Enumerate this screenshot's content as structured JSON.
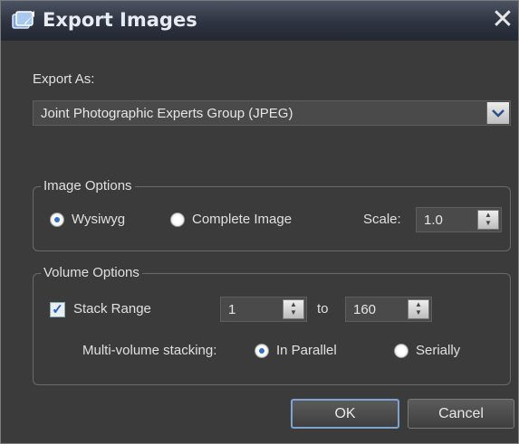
{
  "window": {
    "title": "Export Images",
    "app_icon": "export-images-icon",
    "close_icon": "close-icon"
  },
  "export_as": {
    "label": "Export As:",
    "selected": "Joint Photographic Experts Group (JPEG)"
  },
  "image_options": {
    "legend": "Image Options",
    "wysiwyg_label": "Wysiwyg",
    "complete_label": "Complete Image",
    "selected": "Wysiwyg",
    "scale_label": "Scale:",
    "scale_value": "1.0"
  },
  "volume_options": {
    "legend": "Volume Options",
    "stack_range_label": "Stack Range",
    "stack_range_checked": true,
    "range_from": "1",
    "to_label": "to",
    "range_to": "160",
    "stacking_label": "Multi-volume stacking:",
    "in_parallel_label": "In Parallel",
    "serially_label": "Serially",
    "stacking_selected": "In Parallel"
  },
  "buttons": {
    "ok": "OK",
    "cancel": "Cancel"
  },
  "colors": {
    "accent": "#2f6fcf",
    "background": "#3b3b3b"
  }
}
